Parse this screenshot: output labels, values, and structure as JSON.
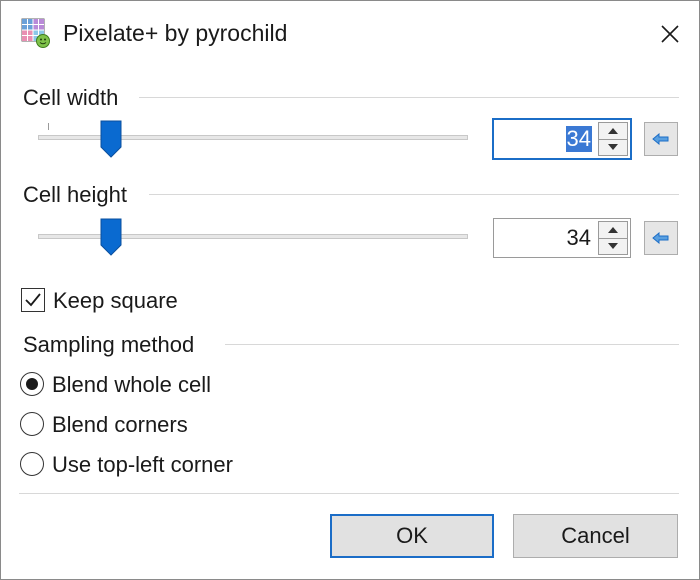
{
  "window": {
    "title": "Pixelate+ by pyrochild"
  },
  "cell_width": {
    "label": "Cell width",
    "value": "34",
    "slider_fraction": 0.17
  },
  "cell_height": {
    "label": "Cell height",
    "value": "34",
    "slider_fraction": 0.17
  },
  "keep_square": {
    "label": "Keep square",
    "checked": true
  },
  "sampling": {
    "label": "Sampling method",
    "options": [
      {
        "label": "Blend whole cell",
        "selected": true
      },
      {
        "label": "Blend corners",
        "selected": false
      },
      {
        "label": "Use top-left corner",
        "selected": false
      }
    ]
  },
  "buttons": {
    "ok": "OK",
    "cancel": "Cancel"
  },
  "colors": {
    "accent": "#1b6dc7",
    "selection": "#3b79d4"
  }
}
